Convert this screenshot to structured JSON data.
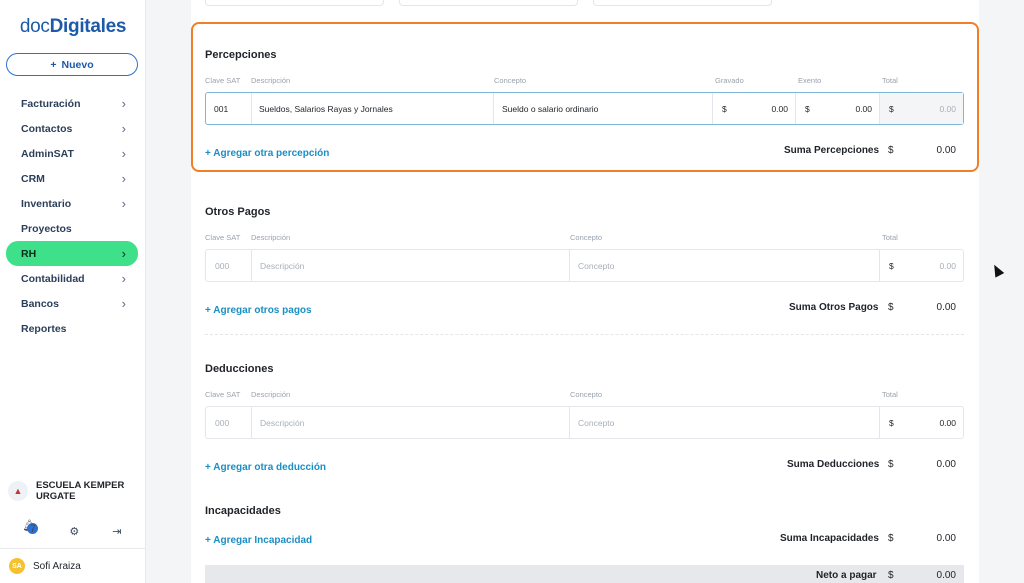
{
  "logo": {
    "doc": "doc",
    "dig": "Digitales"
  },
  "sidebar": {
    "new_button": "Nuevo",
    "items": [
      {
        "label": "Facturación",
        "chevron": true
      },
      {
        "label": "Contactos",
        "chevron": true
      },
      {
        "label": "AdminSAT",
        "chevron": true
      },
      {
        "label": "CRM",
        "chevron": true
      },
      {
        "label": "Inventario",
        "chevron": true
      },
      {
        "label": "Proyectos",
        "chevron": false
      },
      {
        "label": "RH",
        "chevron": true,
        "active": true
      },
      {
        "label": "Contabilidad",
        "chevron": true
      },
      {
        "label": "Bancos",
        "chevron": true
      },
      {
        "label": "Reportes",
        "chevron": false
      }
    ],
    "company": "ESCUELA KEMPER URGATE",
    "notifications_count": "7",
    "user_initials": "SA",
    "user_name": "Sofi Araiza"
  },
  "percepciones": {
    "title": "Percepciones",
    "headers": {
      "clave": "Clave SAT",
      "descripcion": "Descripción",
      "concepto": "Concepto",
      "gravado": "Gravado",
      "exento": "Exento",
      "total": "Total"
    },
    "row": {
      "clave": "001",
      "descripcion": "Sueldos, Salarios Rayas y Jornales",
      "concepto": "Sueldo o salario ordinario",
      "gravado_cur": "$",
      "gravado": "0.00",
      "exento_cur": "$",
      "exento": "0.00",
      "total_cur": "$",
      "total": "0.00"
    },
    "add_link": "+ Agregar otra percepción",
    "sum_label": "Suma Percepciones",
    "sum_cur": "$",
    "sum_value": "0.00"
  },
  "otros_pagos": {
    "title": "Otros Pagos",
    "headers": {
      "clave": "Clave SAT",
      "descripcion": "Descripción",
      "concepto": "Concepto",
      "total": "Total"
    },
    "row": {
      "clave_ph": "000",
      "descripcion_ph": "Descripción",
      "concepto_ph": "Concepto",
      "total_cur": "$",
      "total": "0.00"
    },
    "add_link": "+ Agregar otros pagos",
    "sum_label": "Suma Otros Pagos",
    "sum_cur": "$",
    "sum_value": "0.00"
  },
  "deducciones": {
    "title": "Deducciones",
    "headers": {
      "clave": "Clave SAT",
      "descripcion": "Descripción",
      "concepto": "Concepto",
      "total": "Total"
    },
    "row": {
      "clave_ph": "000",
      "descripcion_ph": "Descripción",
      "concepto_ph": "Concepto",
      "total_cur": "$",
      "total": "0.00"
    },
    "add_link": "+ Agregar otra deducción",
    "sum_label": "Suma Deducciones",
    "sum_cur": "$",
    "sum_value": "0.00"
  },
  "incapacidades": {
    "title": "Incapacidades",
    "add_link": "+ Agregar Incapacidad",
    "sum_label": "Suma Incapacidades",
    "sum_cur": "$",
    "sum_value": "0.00"
  },
  "neto": {
    "label": "Neto a pagar",
    "cur": "$",
    "value": "0.00"
  },
  "colors": {
    "accent": "#1a8fc4",
    "active_nav": "#3ee08a",
    "highlight": "#f07f29",
    "brand": "#1d5aa8"
  }
}
